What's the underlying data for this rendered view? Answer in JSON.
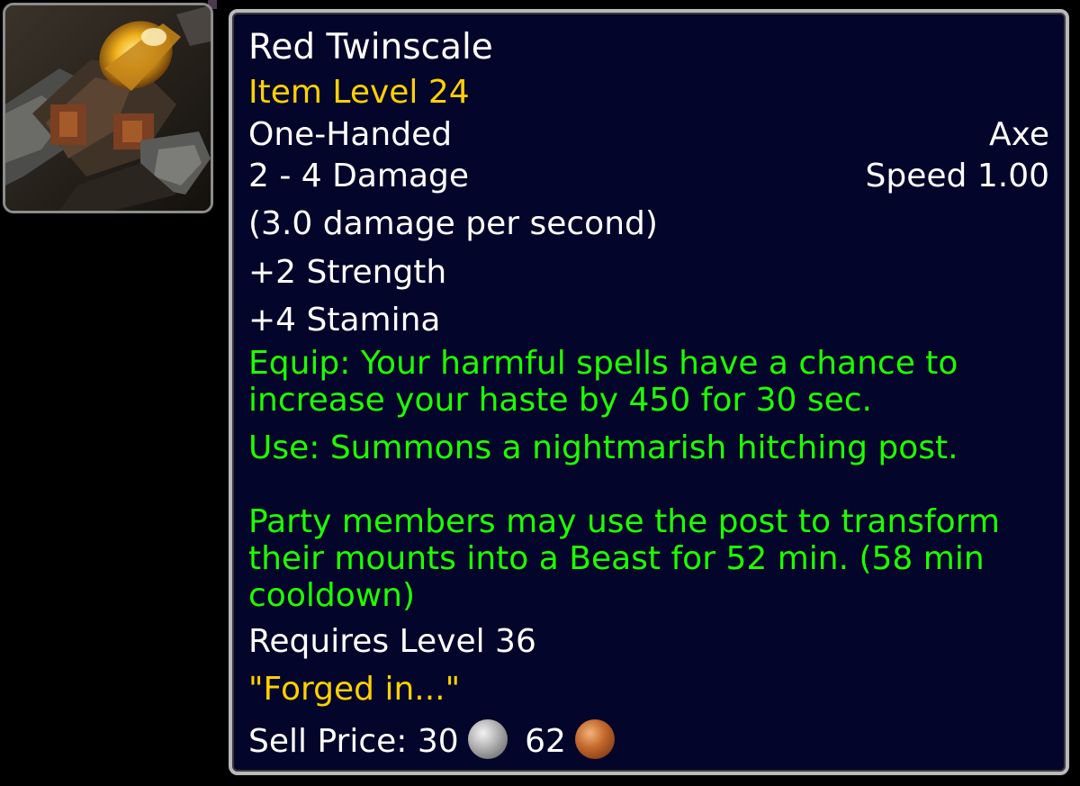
{
  "item": {
    "icon": "red-axe-item-icon",
    "name": "Red Twinscale",
    "item_level": "Item Level 24",
    "hand": "One-Handed",
    "weapon_type": "Axe",
    "damage": "2 - 4 Damage",
    "speed": "Speed 1.00",
    "dps": "(3.0 damage per second)",
    "stat_strength": "+2 Strength",
    "stat_stamina": "+4 Stamina",
    "equip_effect": "Equip: Your harmful spells have a chance to increase your haste by 450 for 30 sec.",
    "use_effect": "Use: Summons a nightmarish hitching post.",
    "use_effect_detail": "Party members may use the post to transform their mounts into a Beast for 52 min. (58 min cooldown)",
    "requires": "Requires Level 36",
    "flavor": "\"Forged in...\"",
    "sell_label": "Sell Price:",
    "sell_silver": "30",
    "sell_copper": "62"
  },
  "colors": {
    "tooltip_bg": "#03052a",
    "border": "#b9b9b9",
    "white_text": "#ffffff",
    "gold_text": "#ffd100",
    "green_text": "#1eff00"
  }
}
